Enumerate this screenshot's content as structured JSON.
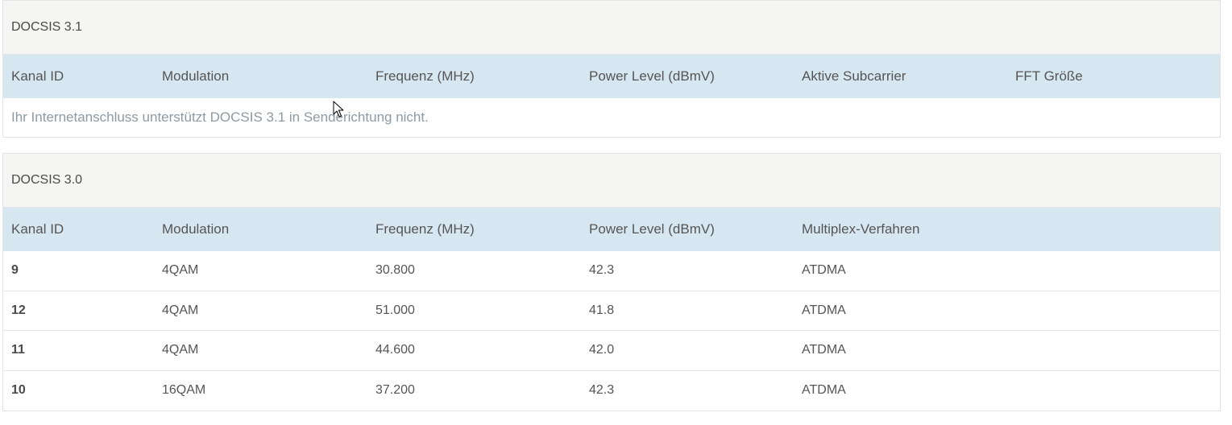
{
  "docsis31": {
    "title": "DOCSIS 3.1",
    "columns": [
      "Kanal ID",
      "Modulation",
      "Frequenz (MHz)",
      "Power Level (dBmV)",
      "Aktive Subcarrier",
      "FFT Größe"
    ],
    "note": "Ihr Internetanschluss unterstützt DOCSIS 3.1 in Senderichtung nicht."
  },
  "docsis30": {
    "title": "DOCSIS 3.0",
    "columns": [
      "Kanal ID",
      "Modulation",
      "Frequenz (MHz)",
      "Power Level (dBmV)",
      "Multiplex-Verfahren"
    ],
    "rows": [
      {
        "kanal_id": "9",
        "modulation": "4QAM",
        "frequenz": "30.800",
        "power": "42.3",
        "multiplex": "ATDMA"
      },
      {
        "kanal_id": "12",
        "modulation": "4QAM",
        "frequenz": "51.000",
        "power": "41.8",
        "multiplex": "ATDMA"
      },
      {
        "kanal_id": "11",
        "modulation": "4QAM",
        "frequenz": "44.600",
        "power": "42.0",
        "multiplex": "ATDMA"
      },
      {
        "kanal_id": "10",
        "modulation": "16QAM",
        "frequenz": "37.200",
        "power": "42.3",
        "multiplex": "ATDMA"
      }
    ]
  },
  "colors": {
    "header_bg": "#d7e7f2",
    "title_bg": "#f5f5f3",
    "note_text": "#8e9aa3"
  },
  "icons": {
    "cursor": "mouse-pointer-icon"
  }
}
